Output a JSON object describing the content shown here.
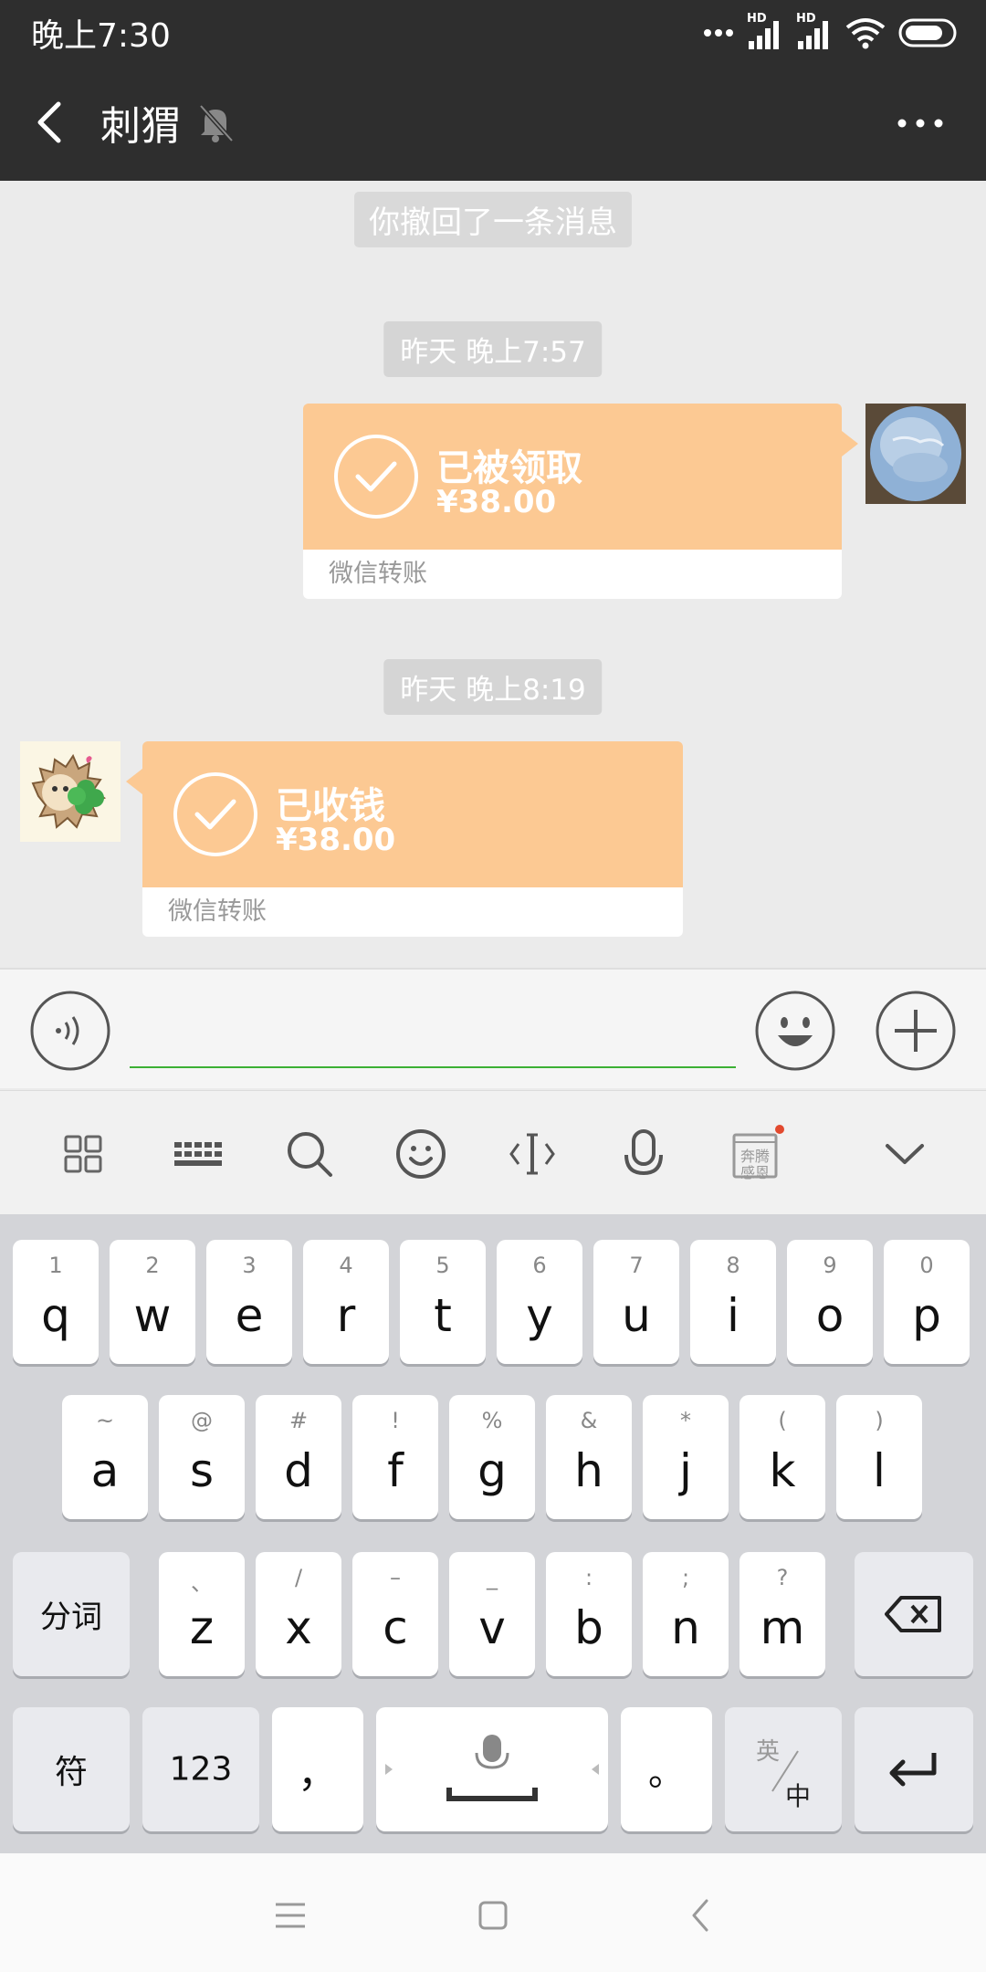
{
  "status_bar": {
    "time": "晚上7:30",
    "signal1_tag": "HD",
    "signal2_tag": "HD"
  },
  "header": {
    "title": "刺猬"
  },
  "messages": {
    "recall_notice": "你撤回了一条消息",
    "time1": "昨天 晚上7:57",
    "sent_transfer": {
      "status": "已被领取",
      "amount": "¥38.00",
      "footer": "微信转账"
    },
    "time2": "昨天 晚上8:19",
    "received_transfer": {
      "status": "已收钱",
      "amount": "¥38.00",
      "footer": "微信转账"
    }
  },
  "input": {
    "value": "",
    "placeholder": ""
  },
  "keyboard_toolbar": {
    "items": [
      "grid-icon",
      "keyboard-icon",
      "search-icon",
      "smiley-icon",
      "cursor-icon",
      "microphone-icon",
      "sticker-icon",
      "collapse-chevron-icon"
    ],
    "sticker_text_top": "奔腾",
    "sticker_text_bottom": "感恩"
  },
  "keyboard": {
    "row1": [
      {
        "main": "q",
        "sub": "1"
      },
      {
        "main": "w",
        "sub": "2"
      },
      {
        "main": "e",
        "sub": "3"
      },
      {
        "main": "r",
        "sub": "4"
      },
      {
        "main": "t",
        "sub": "5"
      },
      {
        "main": "y",
        "sub": "6"
      },
      {
        "main": "u",
        "sub": "7"
      },
      {
        "main": "i",
        "sub": "8"
      },
      {
        "main": "o",
        "sub": "9"
      },
      {
        "main": "p",
        "sub": "0"
      }
    ],
    "row2": [
      {
        "main": "a",
        "sub": "~"
      },
      {
        "main": "s",
        "sub": "@"
      },
      {
        "main": "d",
        "sub": "#"
      },
      {
        "main": "f",
        "sub": "!"
      },
      {
        "main": "g",
        "sub": "%"
      },
      {
        "main": "h",
        "sub": "&"
      },
      {
        "main": "j",
        "sub": "*"
      },
      {
        "main": "k",
        "sub": "("
      },
      {
        "main": "l",
        "sub": ")"
      }
    ],
    "row3": [
      {
        "main": "z",
        "sub": "、"
      },
      {
        "main": "x",
        "sub": "/"
      },
      {
        "main": "c",
        "sub": "–"
      },
      {
        "main": "v",
        "sub": "_"
      },
      {
        "main": "b",
        "sub": ":"
      },
      {
        "main": "n",
        "sub": ";"
      },
      {
        "main": "m",
        "sub": "?"
      }
    ],
    "fenci_label": "分词",
    "fu_label": "符",
    "num_label": "123",
    "comma_label": "，",
    "period_label": "。",
    "lang_top": "英",
    "lang_bottom": "中"
  },
  "colors": {
    "header_bg": "#2e2e2e",
    "transfer_bg": "#fcc993",
    "input_underline": "#3cb034",
    "sticker_dot": "#e2492e"
  }
}
